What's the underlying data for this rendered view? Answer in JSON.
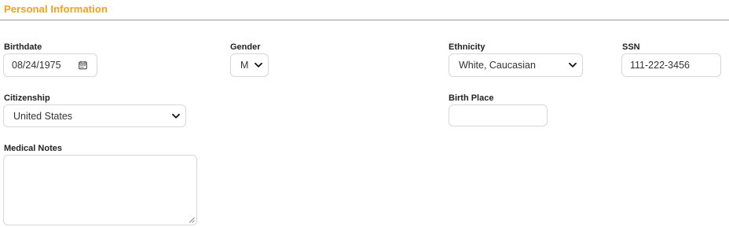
{
  "section": {
    "title": "Personal Information"
  },
  "fields": {
    "birthdate": {
      "label": "Birthdate",
      "value": "08/24/1975",
      "icon": "calendar-icon"
    },
    "gender": {
      "label": "Gender",
      "value": "M",
      "icon": "chevron-down-icon"
    },
    "ethnicity": {
      "label": "Ethnicity",
      "value": "White, Caucasian",
      "icon": "chevron-down-icon"
    },
    "ssn": {
      "label": "SSN",
      "value": "111-222-3456"
    },
    "citizenship": {
      "label": "Citizenship",
      "value": "United States",
      "icon": "chevron-down-icon"
    },
    "birth_place": {
      "label": "Birth Place",
      "value": ""
    },
    "medical_notes": {
      "label": "Medical Notes",
      "value": ""
    }
  },
  "colors": {
    "accent": "#f0a21c",
    "border": "#d7d7d7",
    "rule": "#9a9a9a"
  }
}
